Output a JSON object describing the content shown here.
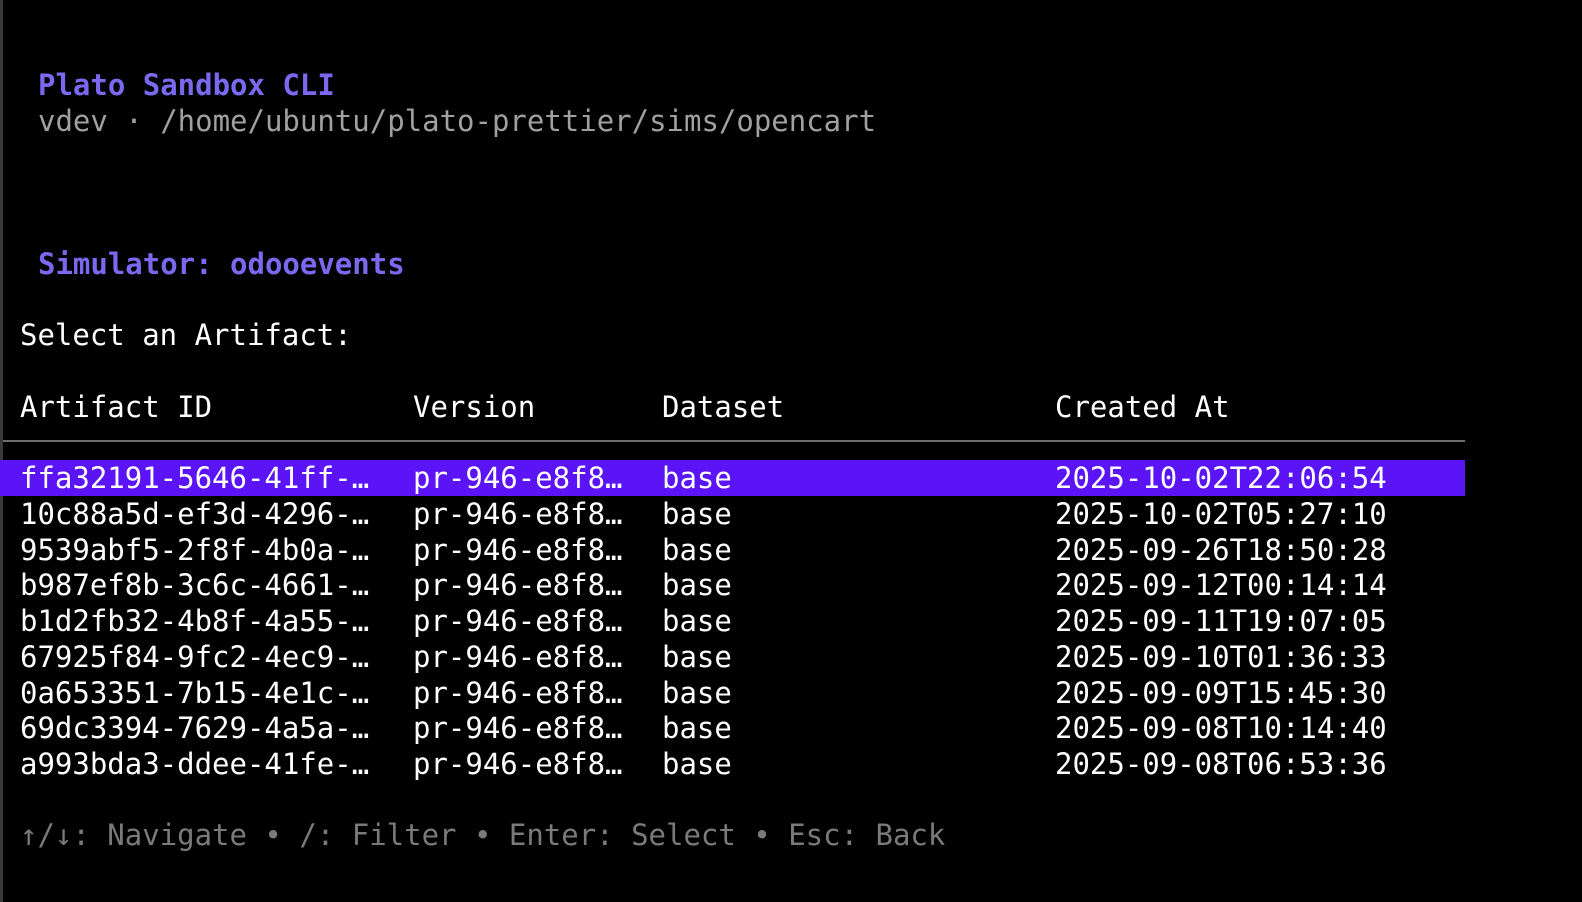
{
  "app": {
    "title": "Plato Sandbox CLI",
    "subtitle": "vdev · /home/ubuntu/plato-prettier/sims/opencart"
  },
  "simulator": {
    "label": "Simulator: odooevents"
  },
  "prompt": "Select an Artifact:",
  "table": {
    "columns": [
      "Artifact ID",
      "Version",
      "Dataset",
      "Created At"
    ],
    "selected_index": 0,
    "rows": [
      {
        "id": "ffa32191-5646-41ff-…",
        "version": "pr-946-e8f8…",
        "dataset": "base",
        "created": "2025-10-02T22:06:54"
      },
      {
        "id": "10c88a5d-ef3d-4296-…",
        "version": "pr-946-e8f8…",
        "dataset": "base",
        "created": "2025-10-02T05:27:10"
      },
      {
        "id": "9539abf5-2f8f-4b0a-…",
        "version": "pr-946-e8f8…",
        "dataset": "base",
        "created": "2025-09-26T18:50:28"
      },
      {
        "id": "b987ef8b-3c6c-4661-…",
        "version": "pr-946-e8f8…",
        "dataset": "base",
        "created": "2025-09-12T00:14:14"
      },
      {
        "id": "b1d2fb32-4b8f-4a55-…",
        "version": "pr-946-e8f8…",
        "dataset": "base",
        "created": "2025-09-11T19:07:05"
      },
      {
        "id": "67925f84-9fc2-4ec9-…",
        "version": "pr-946-e8f8…",
        "dataset": "base",
        "created": "2025-09-10T01:36:33"
      },
      {
        "id": "0a653351-7b15-4e1c-…",
        "version": "pr-946-e8f8…",
        "dataset": "base",
        "created": "2025-09-09T15:45:30"
      },
      {
        "id": "69dc3394-7629-4a5a-…",
        "version": "pr-946-e8f8…",
        "dataset": "base",
        "created": "2025-09-08T10:14:40"
      },
      {
        "id": "a993bda3-ddee-41fe-…",
        "version": "pr-946-e8f8…",
        "dataset": "base",
        "created": "2025-09-08T06:53:36"
      }
    ]
  },
  "help": "↑/↓: Navigate • /: Filter • Enter: Select • Esc: Back",
  "colors": {
    "accent": "#7b68ee",
    "selection": "#5b14f5",
    "muted": "#a0a0a0",
    "help": "#7a7a7a",
    "background": "#000000"
  }
}
